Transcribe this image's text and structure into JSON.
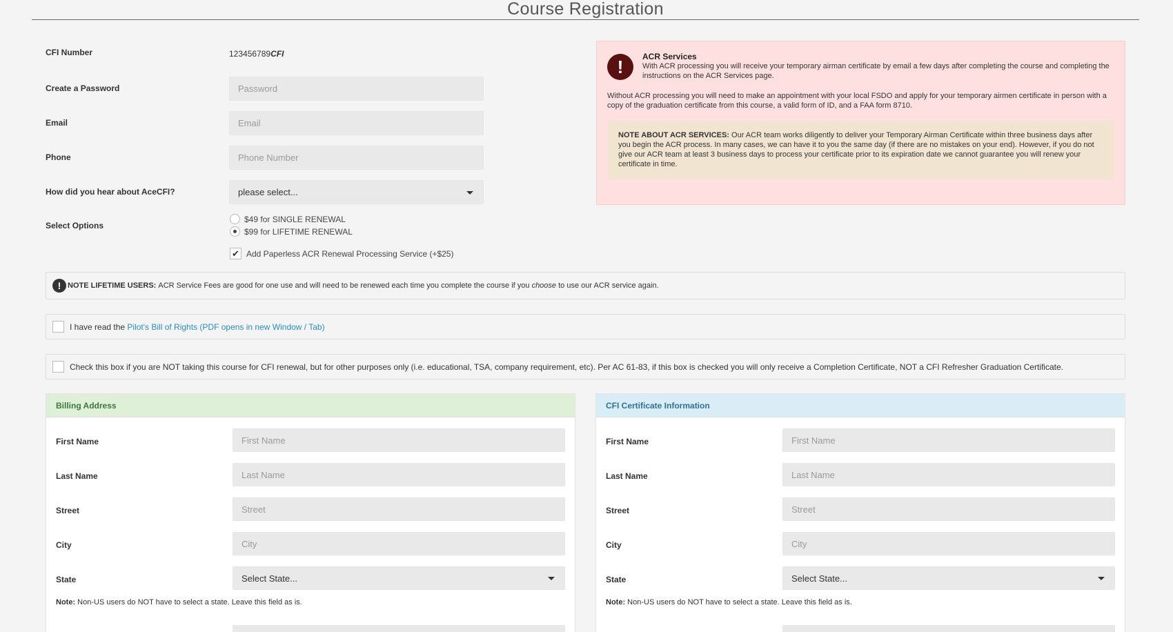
{
  "page": {
    "title": "Course Registration"
  },
  "form": {
    "cfi_number": {
      "label": "CFI Number",
      "value": "123456789",
      "suffix": "CFI"
    },
    "password": {
      "label": "Create a Password",
      "placeholder": "Password"
    },
    "email": {
      "label": "Email",
      "placeholder": "Email"
    },
    "phone": {
      "label": "Phone",
      "placeholder": "Phone Number"
    },
    "referral": {
      "label": "How did you hear about AceCFI?",
      "selected": "please select..."
    },
    "options": {
      "label": "Select Options",
      "single": "$49 for SINGLE RENEWAL",
      "lifetime": "$99 for LIFETIME RENEWAL",
      "selected": "lifetime",
      "acr_addon": "Add Paperless ACR Renewal Processing Service (+$25)",
      "acr_addon_checked": true
    }
  },
  "acr": {
    "title": "ACR Services",
    "text1": "With ACR processing you will receive your temporary airman certificate by email a few days after completing the course and completing the instructions on the ACR Services page.",
    "text2": "Without ACR processing you will need to make an appointment with your local FSDO and apply for your temporary airmen certificate in person with a copy of the graduation certificate from this course, a valid form of ID, and a FAA form 8710.",
    "note_label": "NOTE ABOUT ACR SERVICES:",
    "note_text": "Our ACR team works diligently to deliver your Temporary Airman Certificate within three business days after you begin the ACR process. In many cases, we can have it to you the same day (if there are no mistakes on your end). However, if you do not give our ACR team at least 3 business days to process your certificate prior to its expiration date we cannot guarantee you will renew your certificate in time."
  },
  "notices": {
    "lifetime_label": "NOTE LIFETIME USERS:",
    "lifetime_text1": "ACR Service Fees are good for one use and will need to be renewed each time you complete the course if you",
    "lifetime_emph": "choose",
    "lifetime_text2": "to use our ACR service again.",
    "bill_of_rights_prefix": "I have read the",
    "bill_of_rights_link": "Pilot's Bill of Rights (PDF opens in new Window / Tab)",
    "not_renewal": "Check this box if you are NOT taking this course for CFI renewal, but for other purposes only (i.e. educational, TSA, company requirement, etc). Per AC 61-83, if this box is checked you will only receive a Completion Certificate, NOT a CFI Refresher Graduation Certificate."
  },
  "billing": {
    "title": "Billing Address",
    "first_name": {
      "label": "First Name",
      "placeholder": "First Name"
    },
    "last_name": {
      "label": "Last Name",
      "placeholder": "Last Name"
    },
    "street": {
      "label": "Street",
      "placeholder": "Street"
    },
    "city": {
      "label": "City",
      "placeholder": "City"
    },
    "state": {
      "label": "State",
      "selected": "Select State..."
    },
    "note_label": "Note:",
    "note_text": "Non-US users do NOT have to select a state. Leave this field as is."
  },
  "certificate": {
    "title": "CFI Certificate Information",
    "first_name": {
      "label": "First Name",
      "placeholder": "First Name"
    },
    "last_name": {
      "label": "Last Name",
      "placeholder": "Last Name"
    },
    "street": {
      "label": "Street",
      "placeholder": "Street"
    },
    "city": {
      "label": "City",
      "placeholder": "City"
    },
    "state": {
      "label": "State",
      "selected": "Select State..."
    },
    "note_label": "Note:",
    "note_text": "Non-US users do NOT have to select a state. Leave this field as is."
  }
}
